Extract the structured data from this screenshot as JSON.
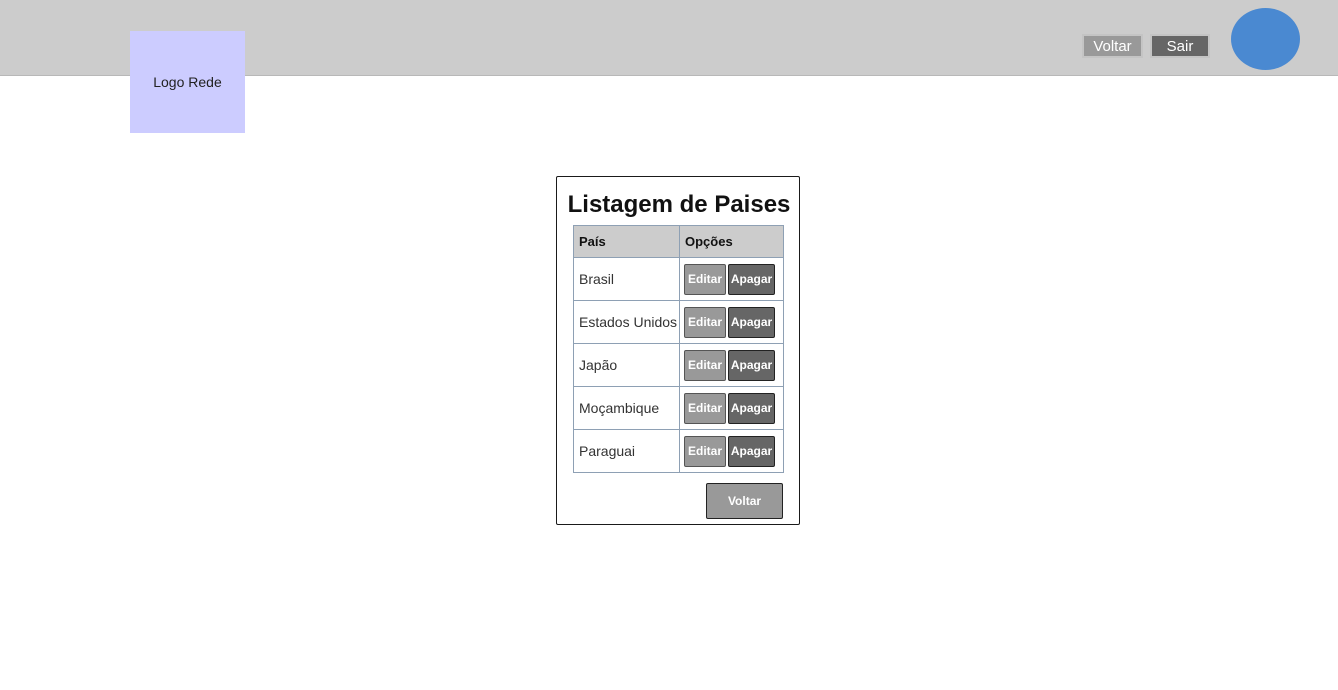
{
  "header": {
    "logo_text": "Logo Rede",
    "voltar_label": "Voltar",
    "sair_label": "Sair",
    "avatar_icon": "user-avatar-icon",
    "avatar_color": "#4a89d1"
  },
  "main": {
    "title": "Listagem de Paises",
    "columns": [
      "País",
      "Opções"
    ],
    "rows": [
      {
        "country": "Brasil",
        "edit_label": "Editar",
        "delete_label": "Apagar"
      },
      {
        "country": "Estados Unidos",
        "edit_label": "Editar",
        "delete_label": "Apagar"
      },
      {
        "country": "Japão",
        "edit_label": "Editar",
        "delete_label": "Apagar"
      },
      {
        "country": "Moçambique",
        "edit_label": "Editar",
        "delete_label": "Apagar"
      },
      {
        "country": "Paraguai",
        "edit_label": "Editar",
        "delete_label": "Apagar"
      }
    ],
    "back_label": "Voltar"
  }
}
